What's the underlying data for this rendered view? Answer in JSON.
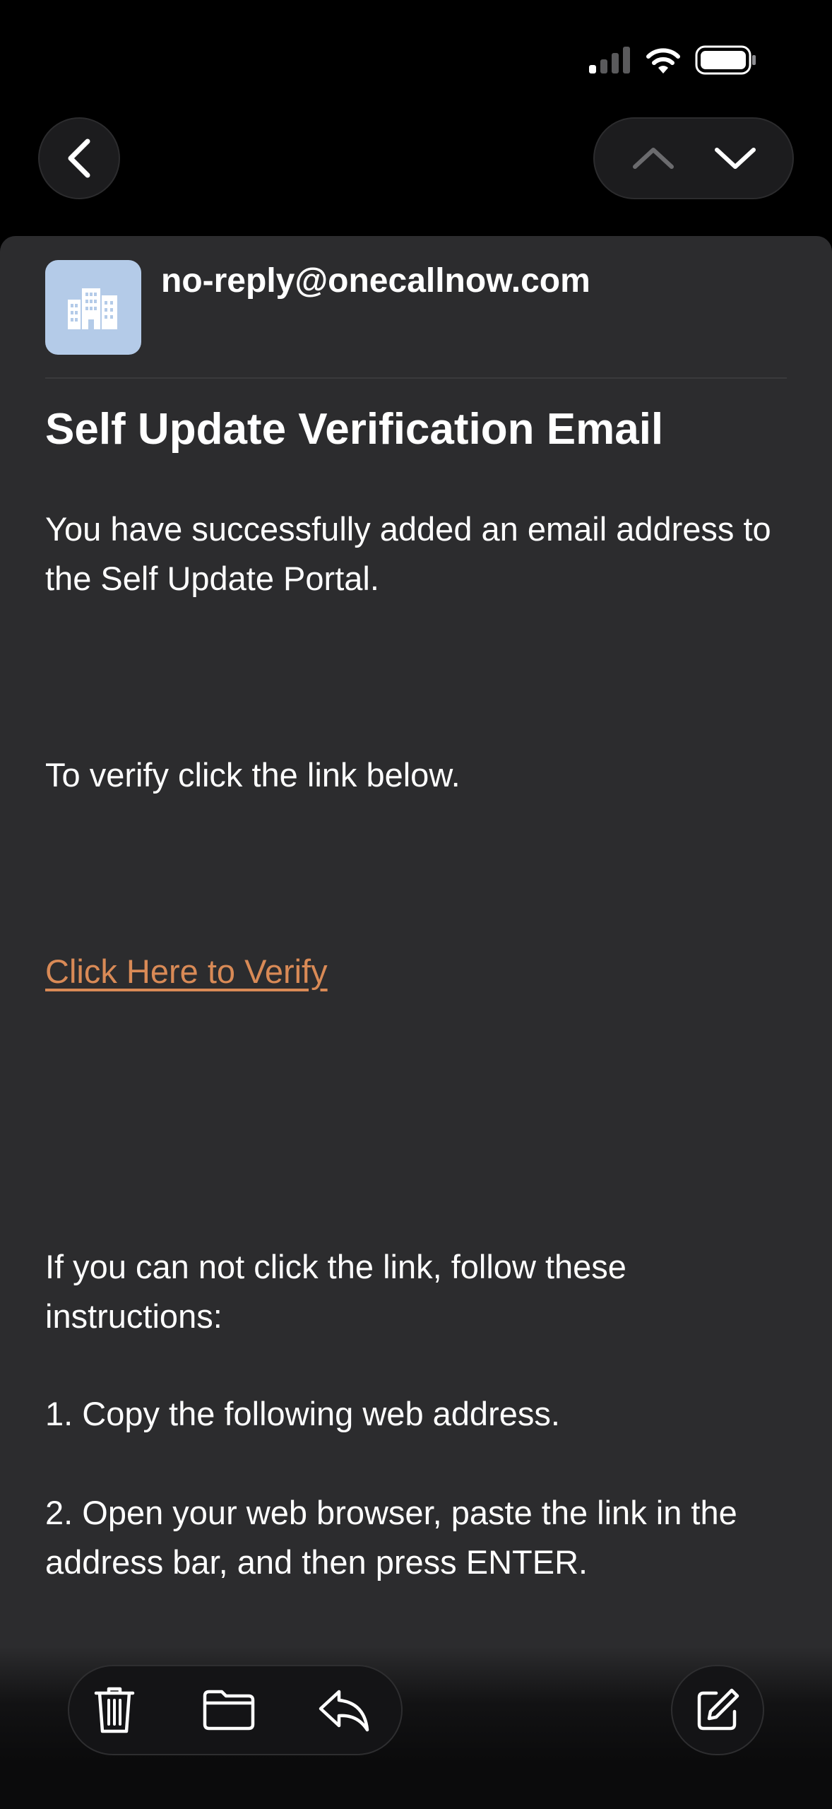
{
  "email": {
    "sender": "no-reply@onecallnow.com",
    "subject": "Self Update Verification Email",
    "paragraphs": {
      "added": "You have successfully added an email address to the Self Update Portal.",
      "verify_prompt": "To verify click the link below.",
      "cannot_click": "If you can not click the link, follow these instructions:",
      "step1": "1. Copy the following web address.",
      "step2": "2. Open your web browser, paste the link in the address bar, and then press ENTER."
    },
    "link_label": "Click Here to Verify"
  },
  "icons": {
    "status": [
      "cellular-signal-icon",
      "wifi-icon",
      "battery-icon"
    ],
    "nav": [
      "back-chevron-icon",
      "chevron-up-icon",
      "chevron-down-icon"
    ],
    "avatar": "building-icon",
    "toolbar": [
      "trash-icon",
      "folder-icon",
      "reply-icon",
      "compose-icon"
    ]
  },
  "colors": {
    "background": "#000000",
    "sheet": "#2c2c2e",
    "avatar_bg": "#b4cbe8",
    "link": "#d98a56",
    "text": "#ffffff"
  }
}
